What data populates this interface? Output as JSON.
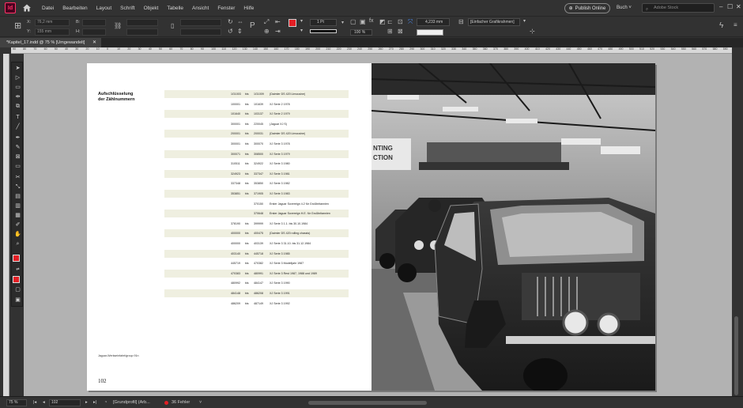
{
  "menubar": {
    "app_icon": "Id",
    "items": [
      "Datei",
      "Bearbeiten",
      "Layout",
      "Schrift",
      "Objekt",
      "Tabelle",
      "Ansicht",
      "Fenster",
      "Hilfe"
    ],
    "publish_label": "Publish Online",
    "workspace_label": "Buch",
    "stock_placeholder": "Adobe Stock",
    "window_controls": [
      "–",
      "☐",
      "✕"
    ]
  },
  "controlbar": {
    "x_label": "X:",
    "y_label": "Y:",
    "w_label": "B:",
    "h_label": "H:",
    "x_value": "76,2 mm",
    "y_value": "155 mm",
    "stroke_weight": "1 Pt",
    "opacity": "100 %",
    "dimension": "4,233 mm",
    "object_style": "[Einfacher Grafikrahmen]",
    "fill_color": "#e31e24"
  },
  "tab": {
    "title": "*Kapitel_17.indd @ 75 % [Umgewandelt]",
    "close": "✕"
  },
  "ruler": {
    "h_ticks": [
      "70",
      "80",
      "90",
      "100",
      "110",
      "120",
      "130",
      "140",
      "150",
      "160",
      "170",
      "180",
      "190",
      "200",
      "210",
      "220",
      "230",
      "240",
      "250",
      "260",
      "270",
      "280",
      "290",
      "300",
      "310",
      "320",
      "330",
      "340",
      "350",
      "360",
      "370",
      "380",
      "390",
      "400",
      "410",
      "420",
      "430",
      "440",
      "450",
      "460",
      "470",
      "480",
      "490",
      "500",
      "510",
      "520",
      "530",
      "540",
      "550",
      "560",
      "570",
      "580",
      "590"
    ],
    "h_ticks_left": [
      "90",
      "80",
      "70",
      "60",
      "50",
      "40",
      "30",
      "20",
      "10",
      "0",
      "10",
      "20",
      "30",
      "40",
      "50",
      "60"
    ]
  },
  "page": {
    "heading_line1": "Aufschlüsselung",
    "heading_line2": "der Zählnummern",
    "caption": "Jaguar-Werkseinfahrt/group 91n",
    "page_number": "102"
  },
  "table": {
    "rows": [
      {
        "from": "1G1003",
        "bis": "bis",
        "to": "1G1009",
        "desc": "(Daimler DS 420 Limousine)"
      },
      {
        "from": "100001",
        "bis": "bis",
        "to": "101639",
        "desc": "XJ Serie 2 1978"
      },
      {
        "from": "101640",
        "bis": "bis",
        "to": "103137",
        "desc": "XJ Serie 2 1979"
      },
      {
        "from": "300001",
        "bis": "bis",
        "to": "220045",
        "desc": "(Jaguar XJ S)"
      },
      {
        "from": "200001",
        "bis": "bis",
        "to": "200031",
        "desc": "(Daimler DS 420 Limousine)"
      },
      {
        "from": "300001",
        "bis": "bis",
        "to": "300070",
        "desc": "XJ Serie 3 1978"
      },
      {
        "from": "300071",
        "bis": "bis",
        "to": "308500",
        "desc": "XJ Serie 3 1979"
      },
      {
        "from": "310511",
        "bis": "bis",
        "to": "324922",
        "desc": "XJ Serie 3 1980"
      },
      {
        "from": "324923",
        "bis": "bis",
        "to": "337347",
        "desc": "XJ Serie 3 1981"
      },
      {
        "from": "337348",
        "bis": "bis",
        "to": "353850",
        "desc": "XJ Serie 3 1982"
      },
      {
        "from": "353851",
        "bis": "bis",
        "to": "371905",
        "desc": "XJ Serie 3 1983"
      },
      {
        "from": "",
        "bis": "",
        "to": "370150",
        "desc": "Erster Jaguar Sovereign 4.2 für Großbritannien"
      },
      {
        "from": "",
        "bis": "",
        "to": "370648",
        "desc": "Erster Jaguar Sovereign H.E. für Großbritannien"
      },
      {
        "from": "378190",
        "bis": "bis",
        "to": "399999",
        "desc": "XJ Serie 3 1.1. bis 30.10.1984"
      },
      {
        "from": "400000",
        "bis": "bis",
        "to": "400475",
        "desc": "(Daimler DS 420 rolling chassis)"
      },
      {
        "from": "400000",
        "bis": "bis",
        "to": "403139",
        "desc": "XJ Serie 3 31.10. bis 31.12.1984"
      },
      {
        "from": "403140",
        "bis": "bis",
        "to": "445718",
        "desc": "XJ Serie 3 1985"
      },
      {
        "from": "445719",
        "bis": "bis",
        "to": "470382",
        "desc": "XJ Serie 3 Modelljahr 1987"
      },
      {
        "from": "470383",
        "bis": "bis",
        "to": "480991",
        "desc": "XJ Serie 3 Rest 1987, 1988 und 1989"
      },
      {
        "from": "480992",
        "bis": "bis",
        "to": "484147",
        "desc": "XJ Serie 3 1990"
      },
      {
        "from": "484148",
        "bis": "bis",
        "to": "486208",
        "desc": "XJ Serie 3 1991"
      },
      {
        "from": "486209",
        "bis": "bis",
        "to": "487149",
        "desc": "XJ Serie 3 1992"
      }
    ]
  },
  "photo": {
    "sign_text_1": "NTING",
    "sign_text_2": "CTION"
  },
  "statusbar": {
    "zoom": "75 %",
    "page": "102",
    "profile": "[Grundprofil] (Arb...",
    "errors": "36 Fehler"
  }
}
